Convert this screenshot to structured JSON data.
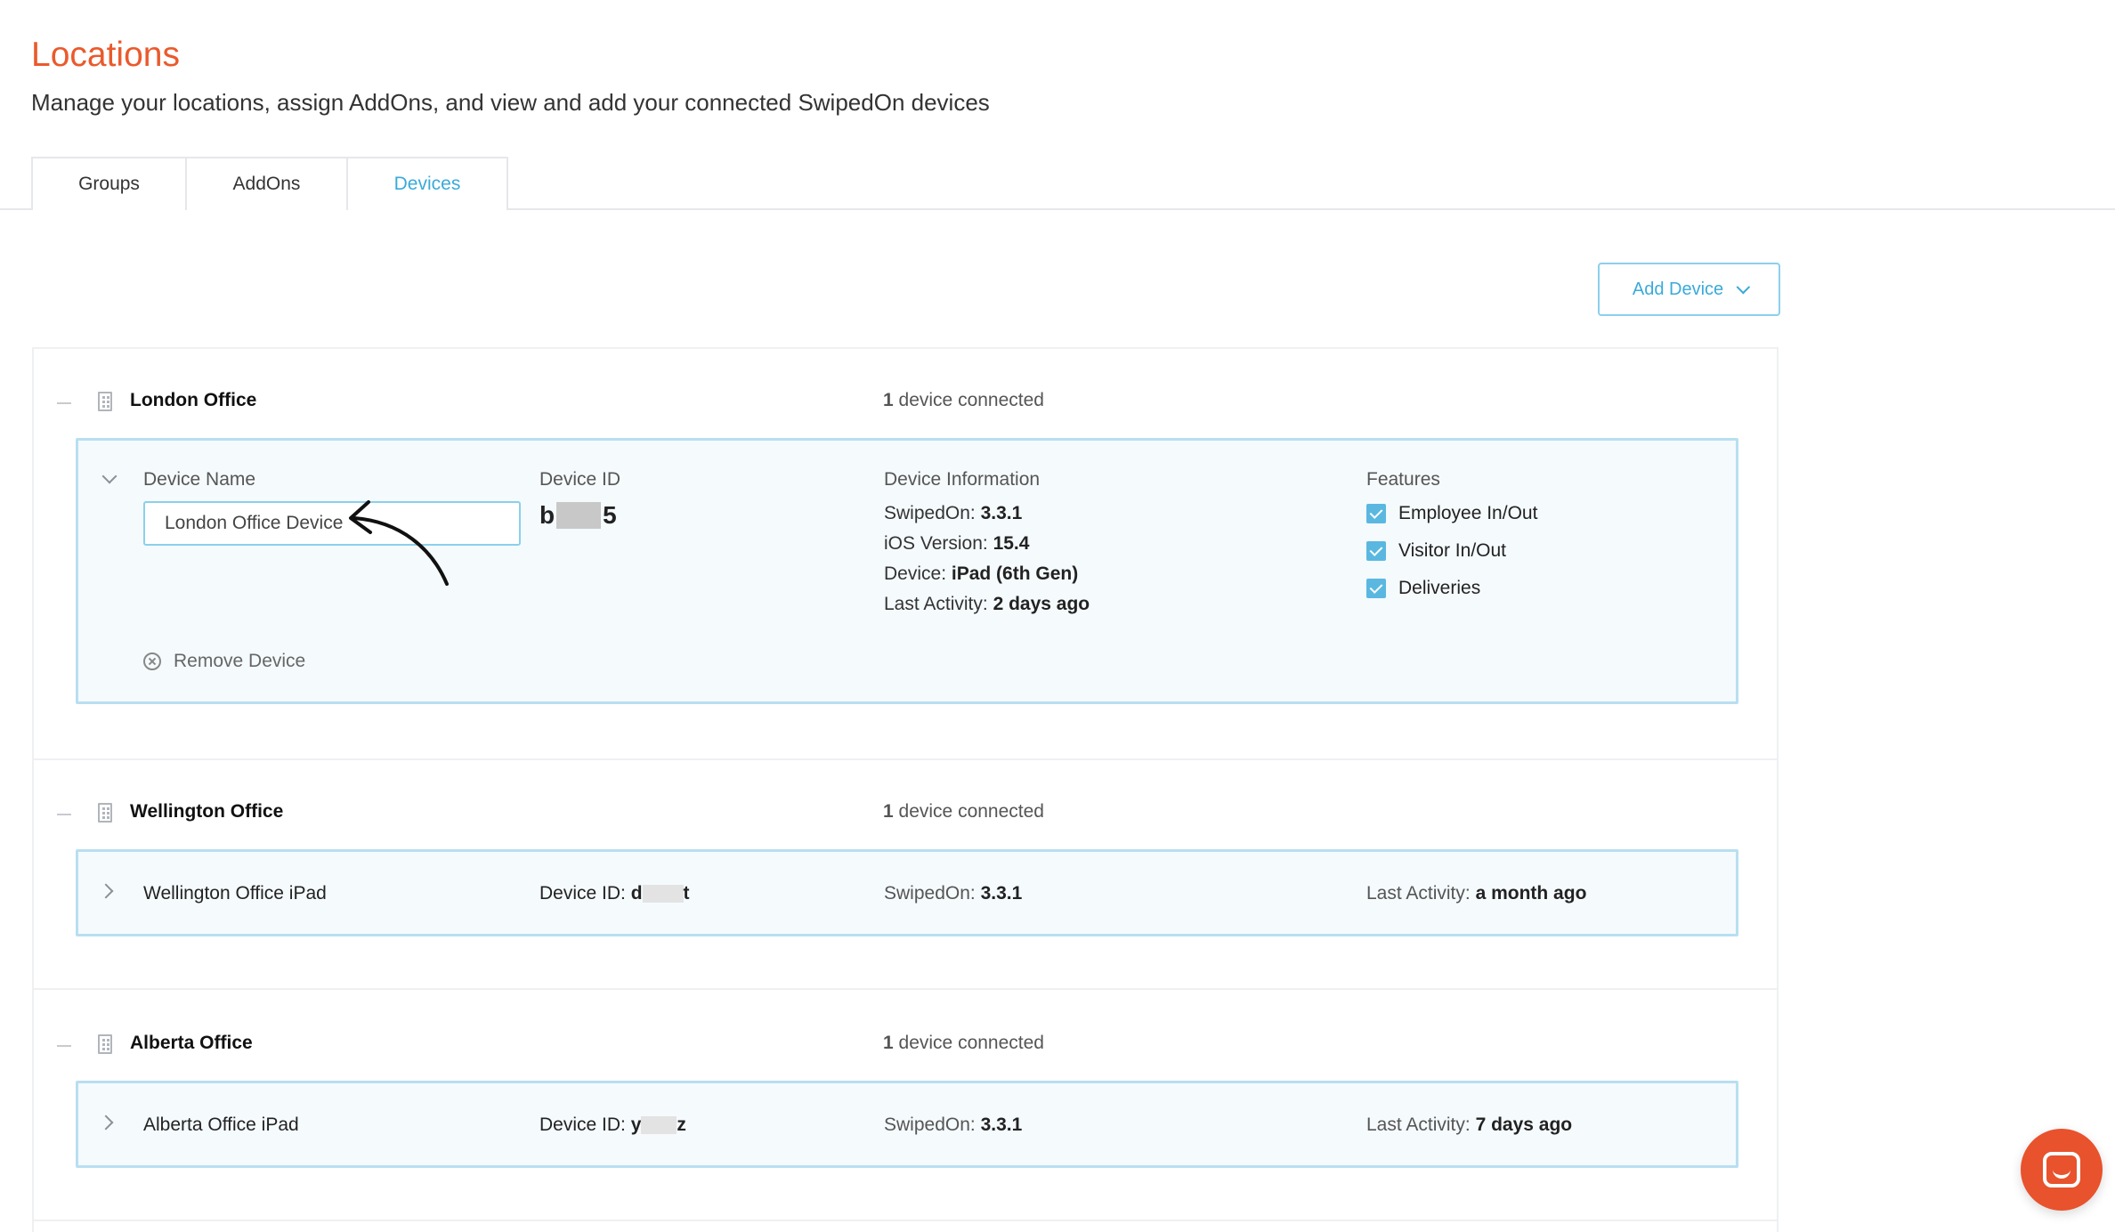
{
  "header": {
    "title": "Locations",
    "subtitle": "Manage your locations, assign AddOns, and view and add your connected SwipedOn devices"
  },
  "tabs": [
    {
      "label": "Groups",
      "active": false
    },
    {
      "label": "AddOns",
      "active": false
    },
    {
      "label": "Devices",
      "active": true
    }
  ],
  "toolbar": {
    "add_device_label": "Add Device"
  },
  "groups": [
    {
      "name": "London Office",
      "count_number": "1",
      "count_text": "device connected",
      "device": {
        "expanded": true,
        "name_label": "Device Name",
        "name_value": "London Office Device",
        "id_label": "Device ID",
        "id_start": "b",
        "id_end": "5",
        "info_label": "Device Information",
        "info": [
          {
            "label": "SwipedOn:",
            "value": "3.3.1"
          },
          {
            "label": "iOS Version:",
            "value": "15.4"
          },
          {
            "label": "Device:",
            "value": "iPad (6th Gen)"
          },
          {
            "label": "Last Activity:",
            "value": "2 days ago"
          }
        ],
        "features_label": "Features",
        "features": [
          "Employee In/Out",
          "Visitor In/Out",
          "Deliveries"
        ],
        "remove_label": "Remove Device"
      }
    },
    {
      "name": "Wellington Office",
      "count_number": "1",
      "count_text": "device connected",
      "device": {
        "expanded": false,
        "name": "Wellington Office iPad",
        "id_label": "Device ID:",
        "id_start": "d",
        "id_end": "t",
        "swipedon_label": "SwipedOn:",
        "swipedon_value": "3.3.1",
        "activity_label": "Last Activity:",
        "activity_value": "a month ago"
      }
    },
    {
      "name": "Alberta Office",
      "count_number": "1",
      "count_text": "device connected",
      "device": {
        "expanded": false,
        "name": "Alberta Office iPad",
        "id_label": "Device ID:",
        "id_start": "y",
        "id_end": "z",
        "swipedon_label": "SwipedOn:",
        "swipedon_value": "3.3.1",
        "activity_label": "Last Activity:",
        "activity_value": "7 days ago"
      }
    }
  ],
  "colors": {
    "brand_orange": "#ea5a2c",
    "accent_blue": "#3aaad9",
    "card_border": "#b8dff0",
    "card_bg": "#f5fafd"
  },
  "icons": [
    "building-icon",
    "chevron-down-icon",
    "chevron-right-icon",
    "check-icon",
    "remove-circle-icon",
    "chat-icon",
    "arrow-annotation"
  ]
}
